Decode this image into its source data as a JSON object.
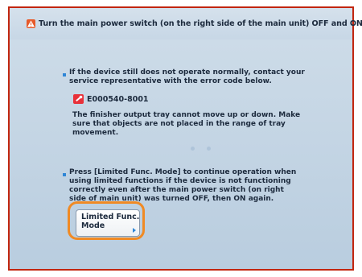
{
  "header": {
    "icon": "warning-icon",
    "message": "Turn the main power switch (on the right side of the main unit) OFF and ON."
  },
  "body": {
    "contact_text": "If the device still does not operate normally, contact your\nservice representative with the error code below.",
    "error_code_icon": "wrench-icon",
    "error_code": "E000540-8001",
    "error_description": "The finisher output tray cannot move up or down. Make\nsure that objects are not placed in the range of tray\nmovement.",
    "limited_text": "Press [Limited Func. Mode] to continue operation when\nusing limited functions if the device is not functioning\ncorrectly even after the main power switch (on right\nside of main unit) was turned OFF, then ON again."
  },
  "limited_button": {
    "label": "Limited Func.\nMode"
  },
  "colors": {
    "frame_border": "#c2260f",
    "panel_bg": "#c7d7e6",
    "highlight": "#f08a24",
    "accent_blue": "#2f86d6"
  }
}
